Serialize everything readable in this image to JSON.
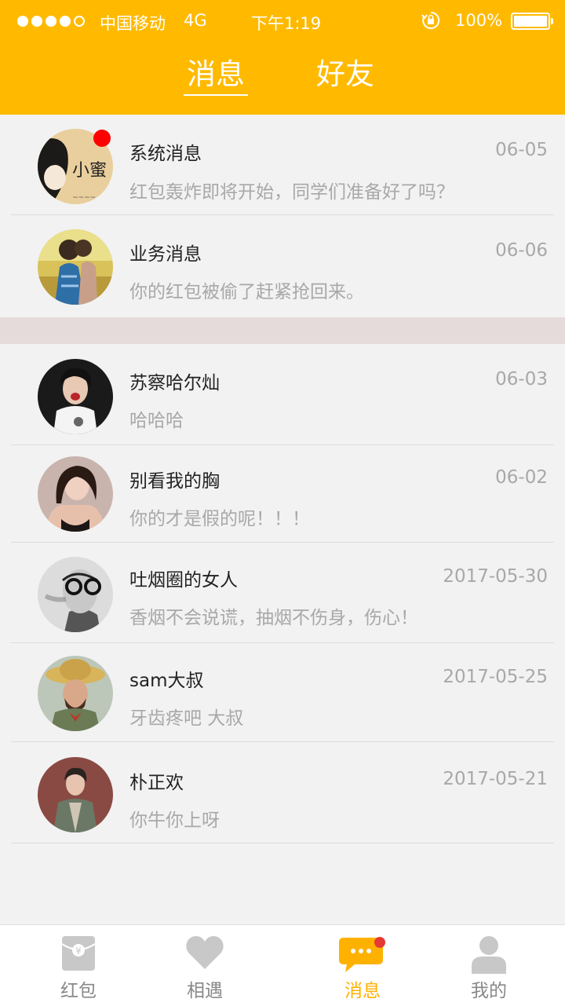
{
  "status_bar": {
    "carrier": "中国移动",
    "network": "4G",
    "time": "下午1:19",
    "battery": "100%"
  },
  "header": {
    "tabs": [
      {
        "label": "消息",
        "active": true
      },
      {
        "label": "好友",
        "active": false
      }
    ]
  },
  "system_messages": [
    {
      "name": "系统消息",
      "date": "06-05",
      "preview": "红包轰炸即将开始，同学们准备好了吗？",
      "unread": true,
      "avatar_text": "小蜜"
    },
    {
      "name": "业务消息",
      "date": "06-06",
      "preview": "你的红包被偷了赶紧抢回来。",
      "unread": false
    }
  ],
  "chats": [
    {
      "name": "苏察哈尔灿",
      "date": "06-03",
      "preview": "哈哈哈"
    },
    {
      "name": "别看我的胸",
      "date": "06-02",
      "preview": "你的才是假的呢！！！"
    },
    {
      "name": "吐烟圈的女人",
      "date": "2017-05-30",
      "preview": "香烟不会说谎，抽烟不伤身，伤心！"
    },
    {
      "name": "sam大叔",
      "date": "2017-05-25",
      "preview": "牙齿疼吧 大叔"
    },
    {
      "name": "朴正欢",
      "date": "2017-05-21",
      "preview": "你牛你上呀"
    }
  ],
  "tabbar": {
    "items": [
      {
        "label": "红包",
        "icon": "red-envelope-icon"
      },
      {
        "label": "相遇",
        "icon": "heart-icon"
      },
      {
        "label": "消息",
        "icon": "chat-bubble-icon",
        "active": true
      },
      {
        "label": "我的",
        "icon": "person-icon"
      }
    ]
  },
  "colors": {
    "brand": "#ffba00",
    "unread_badge": "#ff0000",
    "tab_active": "#ffb100"
  }
}
